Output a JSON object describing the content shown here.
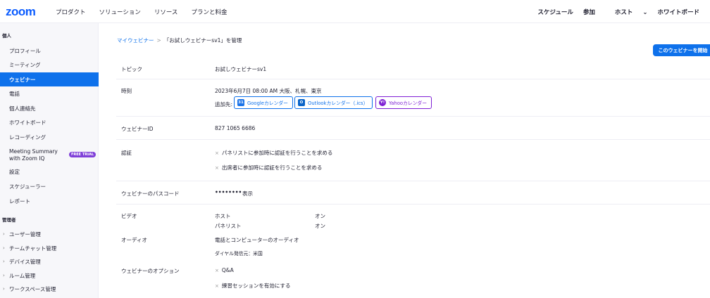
{
  "topnav": {
    "logo": "zoom",
    "left_items": [
      "プロダクト",
      "ソリューション",
      "リソース",
      "プランと料金"
    ],
    "right_items": {
      "schedule": "スケジュール",
      "join": "参加",
      "host": "ホスト",
      "whiteboard": "ホワイトボード"
    }
  },
  "sidebar": {
    "personal_header": "個人",
    "items": [
      {
        "label": "プロフィール"
      },
      {
        "label": "ミーティング"
      },
      {
        "label": "ウェビナー"
      },
      {
        "label": "電話"
      },
      {
        "label": "個人連絡先"
      },
      {
        "label": "ホワイトボード"
      },
      {
        "label": "レコーディング"
      },
      {
        "label": "Meeting Summary with Zoom IQ",
        "badge": "FREE TRIAL"
      },
      {
        "label": "設定"
      },
      {
        "label": "スケジューラー"
      },
      {
        "label": "レポート"
      }
    ],
    "admin_header": "管理者",
    "admin_items": [
      "ユーザー管理",
      "チームチャット管理",
      "デバイス管理",
      "ルーム管理",
      "ワークスペース管理"
    ]
  },
  "breadcrumb": {
    "parent": "マイウェビナー",
    "separator": ">",
    "current": "「お試しウェビナーsv1」を管理"
  },
  "start_button": "このウェビナーを開始",
  "details": {
    "topic_label": "トピック",
    "topic_value": "お試しウェビナーsv1",
    "time_label": "時刻",
    "time_value": "2023年6月7日 08:00 AM 大阪、札幌、東京",
    "add_to_label": "追加先:",
    "calendars": {
      "google": "Googleカレンダー",
      "outlook": "Outlookカレンダー（.ics）",
      "yahoo": "Yahooカレンダー"
    },
    "webinar_id_label": "ウェビナーID",
    "webinar_id_value": "827 1065 6686",
    "auth_label": "認証",
    "auth_options": [
      "パネリストに参加時に認証を行うことを求める",
      "出席者に参加時に認証を行うことを求める"
    ],
    "passcode_label": "ウェビナーのパスコード",
    "passcode_value": "••••••••",
    "show_link": "表示",
    "video_label": "ビデオ",
    "video_host": "ホスト",
    "video_host_value": "オン",
    "video_panelist": "パネリスト",
    "video_panelist_value": "オン",
    "audio_label": "オーディオ",
    "audio_value": "電話とコンピューターのオーディオ",
    "dial_from": "ダイヤル発信元：米国",
    "options_label": "ウェビナーのオプション",
    "options": [
      "Q&A",
      "練習セッションを有効にする"
    ]
  },
  "colors": {
    "accent": "#0e71eb",
    "logo": "#0b5cff",
    "yahoo": "#7e1fd4",
    "badge": "#7f3fd8"
  }
}
